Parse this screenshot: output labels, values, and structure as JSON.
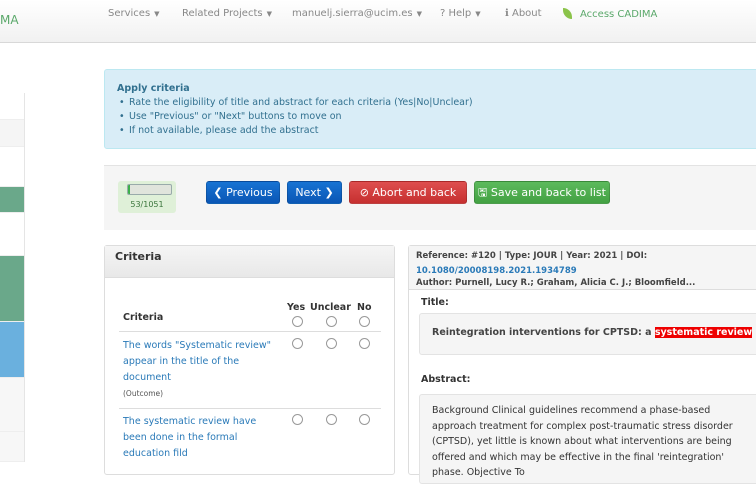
{
  "nav": {
    "logo": "MA",
    "items": [
      {
        "label": "Services"
      },
      {
        "label": "Related Projects"
      },
      {
        "label": "manuelj.sierra@ucim.es"
      },
      {
        "label": "? Help"
      },
      {
        "label": "ℹ About"
      }
    ],
    "access": "Access CADIMA"
  },
  "info": {
    "title": "Apply criteria",
    "bullets": [
      "Rate the eligibility of title and abstract for each criteria (Yes|No|Unclear)",
      "Use \"Previous\" or \"Next\" buttons to move on",
      "If not available, please add the abstract"
    ]
  },
  "progress": {
    "current": 53,
    "total": 1051,
    "label": "53/1051"
  },
  "buttons": {
    "previous": "❮ Previous",
    "next": "Next ❯",
    "abort": "⊘ Abort and back",
    "save": "🖫 Save and back to list"
  },
  "criteria": {
    "title": "Criteria",
    "col_criteria": "Criteria",
    "col_yes": "Yes",
    "col_unclear": "Unclear",
    "col_no": "No",
    "items": [
      {
        "text": "The words \"Systematic review\" appear in the title of the document",
        "category": "(Outcome)"
      },
      {
        "text": "The systematic review have been done in the formal education fild"
      }
    ]
  },
  "reference": {
    "meta": "Reference: #120 | Type: JOUR | Year: 2021 | DOI:",
    "doi": "10.1080/20008198.2021.1934789",
    "author": "Author: Purnell, Lucy R.; Graham, Alicia C. J.; Bloomfield...",
    "title_label": "Title:",
    "title_text": "Reintegration interventions for CPTSD: a ",
    "title_highlight": "systematic review",
    "abstract_label": "Abstract:",
    "abstract": "Background Clinical guidelines recommend a phase-based approach treatment for complex post-traumatic stress disorder (CPTSD), yet little is known about what interventions are being offered and which may be effective in the final 'reintegration' phase. Objective To"
  },
  "colors": {
    "green": "#6aa88a",
    "blue": "#6ab0de",
    "highlight": "#e00000"
  }
}
